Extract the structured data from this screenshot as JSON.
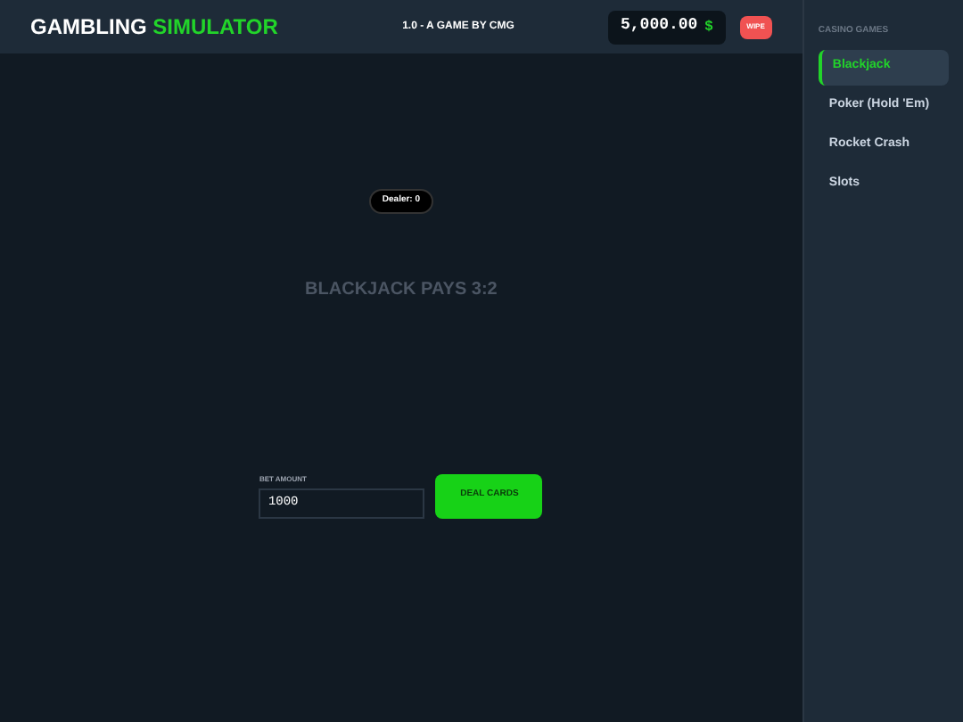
{
  "header": {
    "title_part_1": "GAMBLING",
    "title_part_2": "SIMULATOR",
    "version": "1.0 - A GAME BY CMG",
    "balance": "5,000.00",
    "currency": "$",
    "wipe_button": "WIPE"
  },
  "table": {
    "dealer_badge": "Dealer: 0",
    "slogan": "BLACKJACK PAYS 3:2",
    "bet_label": "BET AMOUNT",
    "bet_value": "1000",
    "deal_button": "DEAL CARDS"
  },
  "sidebar": {
    "heading": "CASINO GAMES",
    "items": [
      {
        "label": "Blackjack",
        "selected": true
      },
      {
        "label": "Poker (Hold 'Em)",
        "selected": false
      },
      {
        "label": "Rocket Crash",
        "selected": false
      },
      {
        "label": "Slots",
        "selected": false
      }
    ]
  }
}
